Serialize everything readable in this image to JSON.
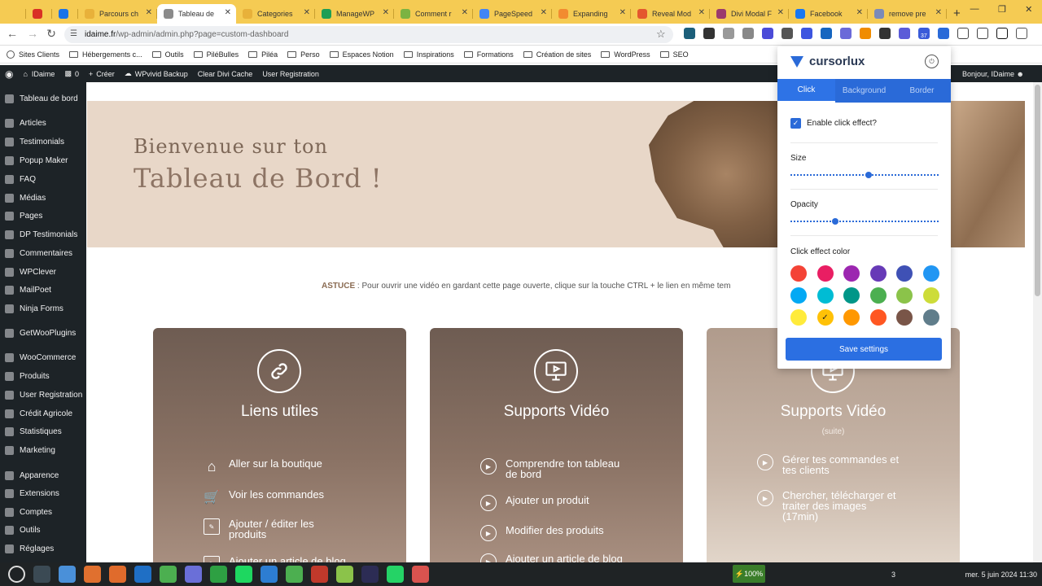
{
  "browser": {
    "tabs": [
      {
        "label": "",
        "color": "#f5cb53",
        "icon": "v-logo-icon"
      },
      {
        "label": "",
        "color": "#d93025",
        "icon": "gmail-icon"
      },
      {
        "label": "",
        "color": "#1a73e8",
        "icon": "app-icon"
      },
      {
        "label": "Parcours ch",
        "color": "#e8b13a"
      },
      {
        "label": "Tableau de",
        "color": "#8b8b8b"
      },
      {
        "label": "Categories",
        "color": "#e8b13a"
      },
      {
        "label": "ManageWP",
        "color": "#1e9e55"
      },
      {
        "label": "Comment r",
        "color": "#7cb342"
      },
      {
        "label": "PageSpeed",
        "color": "#4285f4"
      },
      {
        "label": "Expanding",
        "color": "#f28b30"
      },
      {
        "label": "Reveal Mod",
        "color": "#e4572e"
      },
      {
        "label": "Divi Modal F",
        "color": "#9b3b6d"
      },
      {
        "label": "Facebook",
        "color": "#1877f2"
      },
      {
        "label": "remove pre",
        "color": "#7b8ab8"
      }
    ],
    "active_tab": 4,
    "new_tab": "+",
    "url_host": "idaime.fr",
    "url_path": "/wp-admin/admin.php?page=custom-dashboard",
    "badge": "37"
  },
  "bookmarks": [
    "Sites Clients",
    "Hébergements c...",
    "Outils",
    "PiléBulles",
    "Piléa",
    "Perso",
    "Espaces Notion",
    "Inspirations",
    "Formations",
    "Création de sites",
    "WordPress",
    "SEO"
  ],
  "adminbar": {
    "site": "IDaime",
    "comments": "0",
    "create": "Créer",
    "items": [
      "WPvivid Backup",
      "Clear Divi Cache",
      "User Registration"
    ],
    "greeting": "Bonjour, IDaime"
  },
  "sidebar": [
    {
      "label": "Tableau de bord",
      "top": 0
    },
    {
      "label": "Articles",
      "top": 0
    },
    {
      "label": "Testimonials",
      "top": 0
    },
    {
      "label": "Popup Maker",
      "top": 0
    },
    {
      "label": "FAQ",
      "top": 0
    },
    {
      "label": "Médias",
      "top": 0
    },
    {
      "label": "Pages",
      "top": 0
    },
    {
      "label": "DP Testimonials",
      "top": 0
    },
    {
      "label": "Commentaires",
      "top": 0
    },
    {
      "label": "WPClever",
      "top": 0
    },
    {
      "label": "MailPoet",
      "top": 0
    },
    {
      "label": "Ninja Forms",
      "top": 0
    },
    {
      "label": "GetWooPlugins",
      "top": 0
    },
    {
      "label": "WooCommerce",
      "top": 0
    },
    {
      "label": "Produits",
      "top": 0
    },
    {
      "label": "User Registration",
      "top": 0
    },
    {
      "label": "Crédit Agricole",
      "top": 0
    },
    {
      "label": "Statistiques",
      "top": 0
    },
    {
      "label": "Marketing",
      "top": 0
    },
    {
      "label": "Apparence",
      "top": 0
    },
    {
      "label": "Extensions",
      "top": 0
    },
    {
      "label": "Comptes",
      "top": 0
    },
    {
      "label": "Outils",
      "top": 0
    },
    {
      "label": "Réglages",
      "top": 0
    }
  ],
  "banner": {
    "line1": "Bienvenue sur ton",
    "line2": "Tableau de Bord !"
  },
  "tip": {
    "prefix": "ASTUCE",
    "text": " : Pour ouvrir une vidéo en gardant cette page ouverte, clique sur la touche CTRL + le lien en même tem"
  },
  "cards": [
    {
      "title": "Liens utiles",
      "subtitle": "",
      "items": [
        "Aller sur la boutique",
        "Voir les commandes",
        "Ajouter / éditer les produits",
        "Ajouter un article de blog"
      ]
    },
    {
      "title": "Supports Vidéo",
      "subtitle": "",
      "items": [
        "Comprendre ton tableau de bord",
        "Ajouter un produit",
        "Modifier des produits",
        "Ajouter un article de blog"
      ]
    },
    {
      "title": "Supports Vidéo",
      "subtitle": "(suite)",
      "items": [
        "Gérer tes commandes et tes clients",
        "Chercher, télécharger et traiter des images (17min)"
      ]
    }
  ],
  "popup": {
    "brand": "cursorlux",
    "tabs": [
      "Click",
      "Background",
      "Border"
    ],
    "active_tab": 0,
    "enable_label": "Enable click effect?",
    "enable_checked": true,
    "size_label": "Size",
    "size_value": 0.53,
    "opacity_label": "Opacity",
    "opacity_value": 0.3,
    "color_label": "Click effect color",
    "colors": [
      "#f44336",
      "#e91e63",
      "#9c27b0",
      "#673ab7",
      "#3f51b5",
      "#2196f3",
      "#03a9f4",
      "#00bcd4",
      "#009688",
      "#4caf50",
      "#8bc34a",
      "#cddc39",
      "#ffeb3b",
      "#ffc107",
      "#ff9800",
      "#ff5722",
      "#795548",
      "#607d8b"
    ],
    "selected_color": 13,
    "save_label": "Save settings"
  },
  "taskbar": {
    "battery": "100%",
    "indicator": "3",
    "clock": "mer.  5 juin 2024  11:30",
    "colors": [
      "#6cc04a",
      "#3b4a54",
      "#4a90d9",
      "#e0702f",
      "#e06b2c",
      "#1f6fc5",
      "#4caf50",
      "#6a6fd8",
      "#2ea043",
      "#1ed760",
      "#2d7dd2",
      "#4caf50",
      "#c0392b",
      "#8bc34a",
      "#2c2c54",
      "#25d366",
      "#d9534f"
    ]
  }
}
